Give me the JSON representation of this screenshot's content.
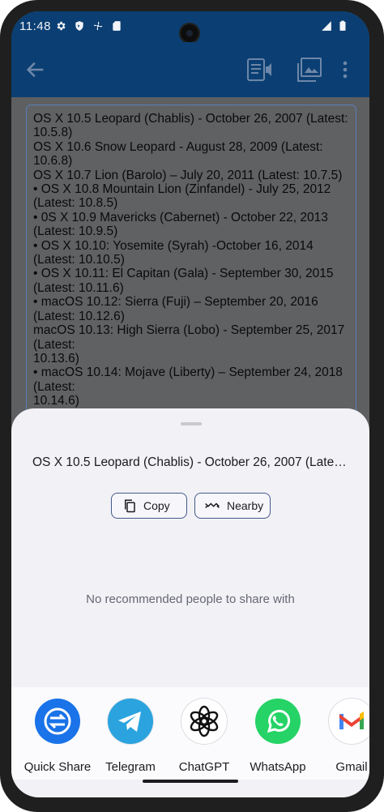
{
  "status_bar": {
    "time": "11:48",
    "icons": [
      "settings-gear-icon",
      "shield-icon",
      "fan-icon",
      "sd-card-icon"
    ],
    "right_icons": [
      "signal-icon",
      "battery-icon"
    ]
  },
  "app_bar": {
    "back_icon": "arrow-back-icon",
    "actions": [
      "text-to-speech-icon",
      "image-icon",
      "more-vert-icon"
    ]
  },
  "text_content": "OS X 10.5 Leopard (Chablis) - October 26, 2007 (Latest: 10.5.8)\nOS X 10.6 Snow Leopard - August 28, 2009 (Latest: 10.6.8)\nOS X 10.7 Lion (Barolo) – July 20, 2011 (Latest: 10.7.5)\n• OS X 10.8 Mountain Lion (Zinfandel) - July 25, 2012 (Latest: 10.8.5)\n• 0S X 10.9 Mavericks (Cabernet) - October 22, 2013 (Latest: 10.9.5)\n• OS X 10.10: Yosemite (Syrah) -October 16, 2014 (Latest: 10.10.5)\n• OS X 10.11: El Capitan (Gala) - September 30, 2015 (Latest: 10.11.6)\n• macOS 10.12: Sierra (Fuji) – September 20, 2016 (Latest: 10.12.6)\nmacOS 10.13: High Sierra (Lobo) - September 25, 2017 (Latest:\n10.13.6)\n• macOS 10.14: Mojave (Liberty) – September 24, 2018 (Latest:\n10.14.6)\n• macOS 10.15: Catalina (Jazz) – October 7, 2019 (Latest:",
  "share_sheet": {
    "preview_text": "OS X 10.5 Leopard (Chablis) - October 26, 2007 (Latest: 10.5.8)",
    "copy_label": "Copy",
    "nearby_label": "Nearby",
    "no_people_text": "No recommended people to share with",
    "apps": [
      {
        "name": "Quick Share",
        "icon": "quick-share-icon",
        "color": "#1a73e8"
      },
      {
        "name": "Telegram",
        "icon": "telegram-icon",
        "color": "#2aa3de"
      },
      {
        "name": "ChatGPT",
        "icon": "chatgpt-icon",
        "color": "#ffffff"
      },
      {
        "name": "WhatsApp",
        "icon": "whatsapp-icon",
        "color": "#25d366"
      },
      {
        "name": "Gmail",
        "icon": "gmail-icon",
        "color": "#ea4335"
      }
    ]
  }
}
